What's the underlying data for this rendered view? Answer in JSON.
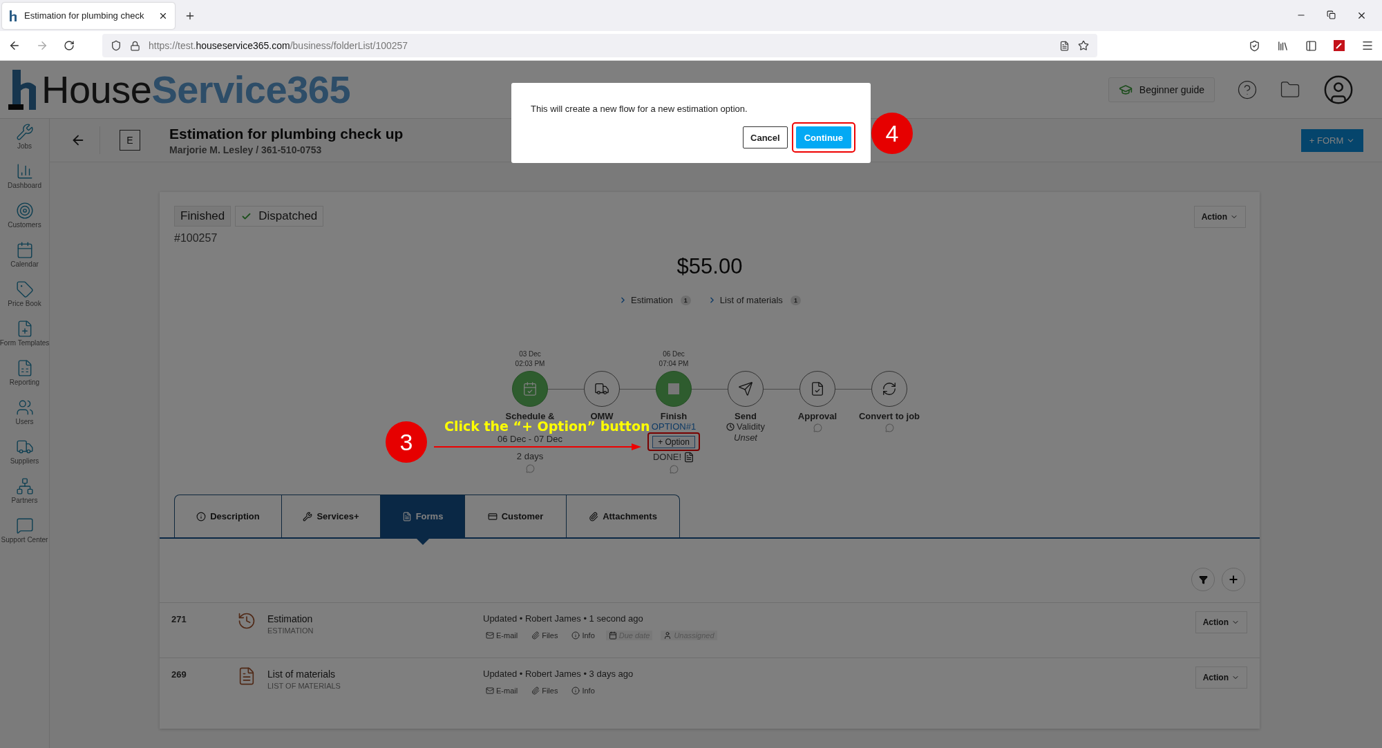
{
  "browser": {
    "tab_title": "Estimation for plumbing check",
    "url": {
      "scheme": "https://test.",
      "domain": "houseservice365.com",
      "path": "/business/folderList/100257"
    }
  },
  "header": {
    "logo": {
      "primary": "House",
      "secondary": "Service365"
    },
    "guide_button": "Beginner guide"
  },
  "sidebar": {
    "items": [
      {
        "label": "Jobs"
      },
      {
        "label": "Dashboard"
      },
      {
        "label": "Customers"
      },
      {
        "label": "Calendar"
      },
      {
        "label": "Price Book"
      },
      {
        "label": "Form Templates"
      },
      {
        "label": "Reporting"
      },
      {
        "label": "Users"
      },
      {
        "label": "Suppliers"
      },
      {
        "label": "Partners"
      },
      {
        "label": "Support Center"
      }
    ]
  },
  "job": {
    "type_badge": "E",
    "title": "Estimation for plumbing check up",
    "subtitle": "Marjorie M. Lesley / 361-510-0753",
    "form_button": "+ FORM"
  },
  "card": {
    "statuses": [
      {
        "label": "Finished",
        "checked": false
      },
      {
        "label": "Dispatched",
        "checked": true
      }
    ],
    "action_button": "Action",
    "number": "#100257",
    "total": "$55.00",
    "links": [
      {
        "label": "Estimation",
        "count": "1"
      },
      {
        "label": "List of materials",
        "count": "1"
      }
    ]
  },
  "workflow": {
    "steps": [
      {
        "done": true,
        "date": "03 Dec",
        "time": "02:03 PM",
        "label": "Schedule &",
        "range": "06 Dec - 07 Dec",
        "duration": "2 days",
        "comment": true
      },
      {
        "done": false,
        "label": "OMW",
        "comment": false
      },
      {
        "done": true,
        "date": "06 Dec",
        "time": "07:04 PM",
        "label": "Finish",
        "option": "OPTION#1",
        "option_button": "+ Option",
        "status": "DONE!",
        "comment": true
      },
      {
        "done": false,
        "label": "Send",
        "validity": "Validity",
        "validity_value": "Unset",
        "comment": false
      },
      {
        "done": false,
        "label": "Approval",
        "comment": true
      },
      {
        "done": false,
        "label": "Convert to job",
        "comment": true
      }
    ]
  },
  "tabs": [
    {
      "label": "Description",
      "selected": false
    },
    {
      "label": "Services+",
      "selected": false
    },
    {
      "label": "Forms",
      "selected": true
    },
    {
      "label": "Customer",
      "selected": false
    },
    {
      "label": "Attachments",
      "selected": false
    }
  ],
  "forms": [
    {
      "number": "271",
      "name": "Estimation",
      "type": "ESTIMATION",
      "updated": "Updated • Robert James • 1 second ago",
      "action_button": "Action",
      "meta": [
        {
          "label": "E-mail",
          "empty": false
        },
        {
          "label": "Files",
          "empty": false
        },
        {
          "label": "Info",
          "empty": false
        },
        {
          "label": "Due date",
          "empty": true
        },
        {
          "label": "Unassigned",
          "empty": true
        }
      ]
    },
    {
      "number": "269",
      "name": "List of materials",
      "type": "LIST OF MATERIALS",
      "updated": "Updated • Robert James • 3 days ago",
      "action_button": "Action",
      "meta": [
        {
          "label": "E-mail",
          "empty": false
        },
        {
          "label": "Files",
          "empty": false
        },
        {
          "label": "Info",
          "empty": false
        }
      ]
    }
  ],
  "dialog": {
    "message": "This will create a new flow for a new estimation option.",
    "cancel_button": "Cancel",
    "continue_button": "Continue"
  },
  "annotations": {
    "option_step": {
      "number": "3",
      "text": "Click the “+ Option” button"
    },
    "continue_step": {
      "number": "4"
    }
  }
}
